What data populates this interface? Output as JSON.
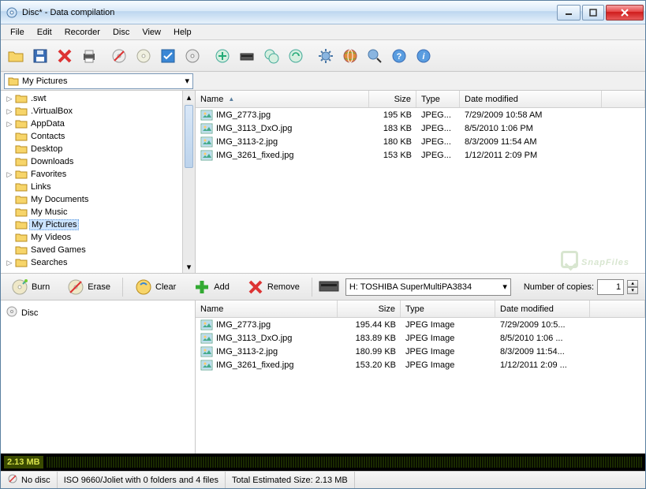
{
  "window": {
    "title": "Disc* - Data compilation"
  },
  "menu": [
    "File",
    "Edit",
    "Recorder",
    "Disc",
    "View",
    "Help"
  ],
  "path_combo": "My Pictures",
  "tree": [
    {
      "label": ".swt",
      "expandable": true
    },
    {
      "label": ".VirtualBox",
      "expandable": true
    },
    {
      "label": "AppData",
      "expandable": true
    },
    {
      "label": "Contacts",
      "expandable": false
    },
    {
      "label": "Desktop",
      "expandable": false
    },
    {
      "label": "Downloads",
      "expandable": false
    },
    {
      "label": "Favorites",
      "expandable": true
    },
    {
      "label": "Links",
      "expandable": false
    },
    {
      "label": "My Documents",
      "expandable": false
    },
    {
      "label": "My Music",
      "expandable": false
    },
    {
      "label": "My Pictures",
      "expandable": false,
      "selected": true
    },
    {
      "label": "My Videos",
      "expandable": false
    },
    {
      "label": "Saved Games",
      "expandable": false
    },
    {
      "label": "Searches",
      "expandable": true
    }
  ],
  "upper_cols": {
    "name": "Name",
    "size": "Size",
    "type": "Type",
    "date": "Date modified"
  },
  "upper_rows": [
    {
      "name": "IMG_2773.jpg",
      "size": "195 KB",
      "type": "JPEG...",
      "date": "7/29/2009 10:58 AM"
    },
    {
      "name": "IMG_3113_DxO.jpg",
      "size": "183 KB",
      "type": "JPEG...",
      "date": "8/5/2010 1:06 PM"
    },
    {
      "name": "IMG_3113-2.jpg",
      "size": "180 KB",
      "type": "JPEG...",
      "date": "8/3/2009 11:54 AM"
    },
    {
      "name": "IMG_3261_fixed.jpg",
      "size": "153 KB",
      "type": "JPEG...",
      "date": "1/12/2011 2:09 PM"
    }
  ],
  "actions": {
    "burn": "Burn",
    "erase": "Erase",
    "clear": "Clear",
    "add": "Add",
    "remove": "Remove"
  },
  "drive": "H: TOSHIBA SuperMultiPA3834",
  "copies_label": "Number of copies:",
  "copies_value": "1",
  "disc_label": "Disc",
  "lower_cols": {
    "name": "Name",
    "size": "Size",
    "type": "Type",
    "date": "Date modified"
  },
  "lower_rows": [
    {
      "name": "IMG_2773.jpg",
      "size": "195.44 KB",
      "type": "JPEG Image",
      "date": "7/29/2009 10:5..."
    },
    {
      "name": "IMG_3113_DxO.jpg",
      "size": "183.89 KB",
      "type": "JPEG Image",
      "date": "8/5/2010 1:06 ..."
    },
    {
      "name": "IMG_3113-2.jpg",
      "size": "180.99 KB",
      "type": "JPEG Image",
      "date": "8/3/2009 11:54..."
    },
    {
      "name": "IMG_3261_fixed.jpg",
      "size": "153.20 KB",
      "type": "JPEG Image",
      "date": "1/12/2011 2:09 ..."
    }
  ],
  "usage": "2.13 MB",
  "status": {
    "nodisc": "No disc",
    "iso": "ISO 9660/Joliet with 0 folders and 4 files",
    "total": "Total Estimated Size: 2.13 MB"
  },
  "watermark": "SnapFiles"
}
